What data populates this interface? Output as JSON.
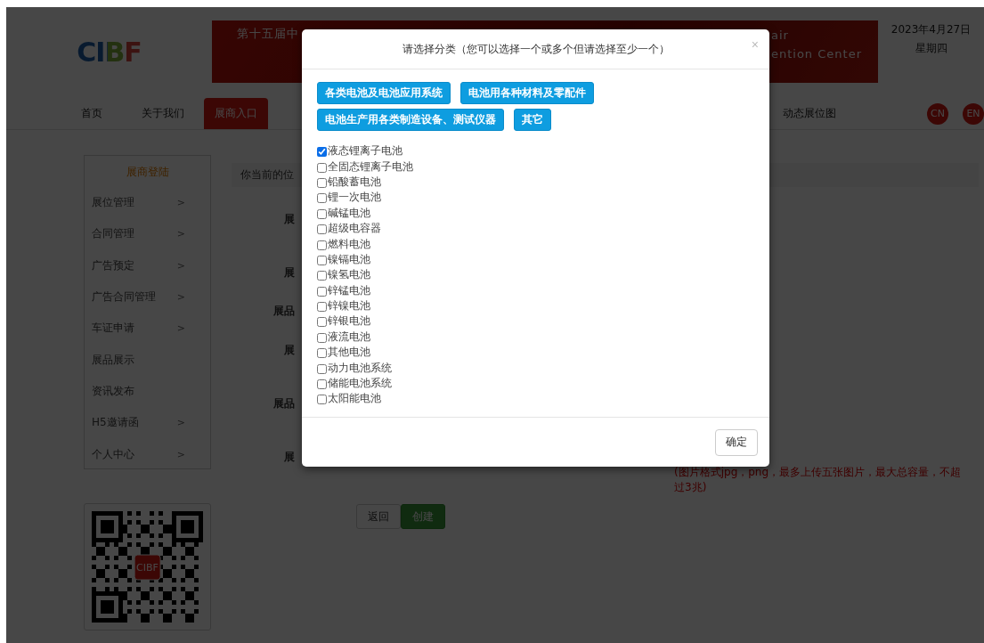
{
  "header": {
    "logo": "CIBF",
    "banner_left": "第十五届中",
    "banner_right": [
      "air",
      "ention Center"
    ],
    "date": "2023年4月27日",
    "weekday": "星期四"
  },
  "nav": {
    "items": [
      {
        "label": "首页",
        "selected": false
      },
      {
        "label": "关于我们",
        "selected": false
      },
      {
        "label": "展商入口",
        "selected": true
      }
    ],
    "right_items": [
      {
        "label": "动态展位图",
        "selected": false
      }
    ],
    "languages": [
      "CN",
      "EN"
    ]
  },
  "sidebar": {
    "title": "展商登陆",
    "items": [
      {
        "label": "展位管理",
        "arrow": ">"
      },
      {
        "label": "合同管理",
        "arrow": ">"
      },
      {
        "label": "广告预定",
        "arrow": ">"
      },
      {
        "label": "广告合同管理",
        "arrow": ">"
      },
      {
        "label": "车证申请",
        "arrow": ">"
      },
      {
        "label": "展品展示"
      },
      {
        "label": "资讯发布"
      },
      {
        "label": "H5邀请函",
        "arrow": ">"
      },
      {
        "label": "个人中心",
        "arrow": ">"
      }
    ],
    "qr_badge": "CIBF"
  },
  "main": {
    "breadcrumb": "你当前的位",
    "form_labels": [
      "展",
      "展",
      "展品",
      "展",
      "展品",
      "展"
    ],
    "upload_note": "(图片格式jpg，png，最多上传五张图片，最大总容量，不超过3兆)",
    "buttons": [
      {
        "label": "返回",
        "kind": "default"
      },
      {
        "label": "创建",
        "kind": "success"
      }
    ]
  },
  "modal": {
    "title": "请选择分类（您可以选择一个或多个但请选择至少一个）",
    "close": "×",
    "category_buttons": [
      [
        "各类电池及电池应用系统",
        "电池用各种材料及零配件"
      ],
      [
        "电池生产用各类制造设备、测试仪器",
        "其它"
      ]
    ],
    "options": [
      {
        "label": "液态锂离子电池",
        "checked": true
      },
      {
        "label": "全固态锂离子电池",
        "checked": false
      },
      {
        "label": "铅酸蓄电池",
        "checked": false
      },
      {
        "label": "锂一次电池",
        "checked": false
      },
      {
        "label": "碱锰电池",
        "checked": false
      },
      {
        "label": "超级电容器",
        "checked": false
      },
      {
        "label": "燃料电池",
        "checked": false
      },
      {
        "label": "镍镉电池",
        "checked": false
      },
      {
        "label": "镍氢电池",
        "checked": false
      },
      {
        "label": "锌锰电池",
        "checked": false
      },
      {
        "label": "锌镍电池",
        "checked": false
      },
      {
        "label": "锌银电池",
        "checked": false
      },
      {
        "label": "液流电池",
        "checked": false
      },
      {
        "label": "其他电池",
        "checked": false
      },
      {
        "label": "动力电池系统",
        "checked": false
      },
      {
        "label": "储能电池系统",
        "checked": false
      },
      {
        "label": "太阳能电池",
        "checked": false
      }
    ],
    "confirm": "确定"
  }
}
